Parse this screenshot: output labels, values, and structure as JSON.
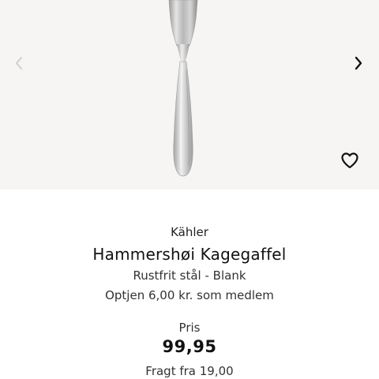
{
  "gallery": {
    "image_alt": "Hammershøi Kagegaffel",
    "prev_icon": "chevron-left-icon",
    "next_icon": "chevron-right-icon",
    "favorite_icon": "heart-outline-icon"
  },
  "product": {
    "brand": "Kähler",
    "title": "Hammershøi Kagegaffel",
    "variant": "Rustfrit stål - Blank",
    "member_offer": "Optjen 6,00 kr. som medlem",
    "price_label": "Pris",
    "price": "99,95",
    "shipping": "Fragt fra 19,00"
  },
  "colors": {
    "gallery_background": "#f6f5f4",
    "text": "#1a1a1a",
    "arrow_disabled": "#d8d2cc"
  }
}
